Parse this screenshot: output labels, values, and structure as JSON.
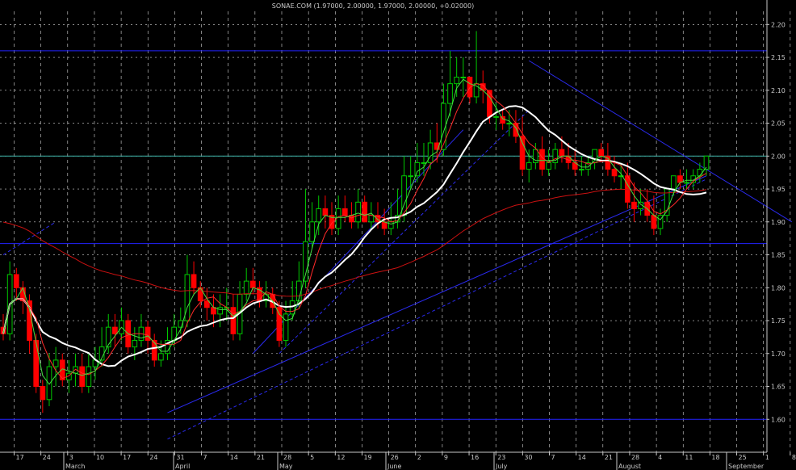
{
  "chart_data": {
    "type": "candlestick",
    "title": "SONAE.COM (1.97000, 2.00000, 1.97000, 2.00000, +0.02000)",
    "ylim": [
      1.55,
      2.22
    ],
    "y_ticks": [
      1.6,
      1.65,
      1.7,
      1.75,
      1.8,
      1.85,
      1.9,
      1.95,
      2.0,
      2.05,
      2.1,
      2.15,
      2.2
    ],
    "y_tick_labels": [
      "1.60",
      "1.65",
      "1.70",
      "1.75",
      "1.80",
      "1.85",
      "1.90",
      "1.95",
      "2.00",
      "2.05",
      "2.10",
      "2.15",
      "2.20"
    ],
    "x_day_labels": [
      "17",
      "24",
      "3",
      "10",
      "17",
      "24",
      "31",
      "7",
      "14",
      "21",
      "28",
      "5",
      "12",
      "19",
      "26",
      "2",
      "9",
      "16",
      "23",
      "30",
      "7",
      "14",
      "21",
      "28",
      "4",
      "11",
      "18",
      "25",
      "1",
      "8"
    ],
    "x_month_labels": [
      "March",
      "April",
      "May",
      "June",
      "July",
      "August",
      "September"
    ],
    "grid": true,
    "up_color": "#00c800",
    "down_color": "#ff0000",
    "colors": {
      "background": "#000000",
      "grid": "#d8d8d8",
      "ma_short": "#44dd44",
      "ma_mid": "#ff2a2a",
      "ma_white": "#ffffff",
      "ma_long": "#cc1111",
      "support_resistance": "#2222ff",
      "highlight_line": "#3fb4a8",
      "trendline": "#2a2aee"
    },
    "horizontal_levels": [
      2.16,
      2.0,
      1.867,
      1.6
    ],
    "series": [
      {
        "open": [
          1.74,
          1.73,
          1.82,
          1.8,
          1.78,
          1.72,
          1.65,
          1.63,
          1.68,
          1.69,
          1.66,
          1.67,
          1.68,
          1.65,
          1.68,
          1.69,
          1.71,
          1.74,
          1.73,
          1.75,
          1.71,
          1.72,
          1.74,
          1.72,
          1.69,
          1.7,
          1.72,
          1.74,
          1.75,
          1.82,
          1.8,
          1.78,
          1.77,
          1.76,
          1.77,
          1.77,
          1.73,
          1.79,
          1.81,
          1.8,
          1.78,
          1.79,
          1.77,
          1.72,
          1.76,
          1.78,
          1.81,
          1.87,
          1.9,
          1.92,
          1.91,
          1.89,
          1.92,
          1.91,
          1.9,
          1.93,
          1.9,
          1.91,
          1.9,
          1.89,
          1.9,
          1.91,
          1.97,
          1.97,
          1.99,
          1.99,
          2.02,
          2.01,
          2.08,
          2.11,
          2.12,
          2.12,
          2.09,
          2.11,
          2.1,
          2.06,
          2.06,
          2.05,
          2.05,
          2.03,
          1.98,
          1.99,
          2.01,
          1.98,
          1.99,
          2.01,
          2.0,
          1.99,
          1.98,
          1.98,
          1.99,
          2.01,
          2.0,
          1.98,
          1.97,
          1.97,
          1.93,
          1.92,
          1.93,
          1.91,
          1.89,
          1.91,
          1.95,
          1.97,
          1.96,
          1.96,
          1.97,
          1.98
        ],
        "close": [
          1.73,
          1.82,
          1.8,
          1.78,
          1.72,
          1.65,
          1.63,
          1.68,
          1.69,
          1.66,
          1.67,
          1.68,
          1.65,
          1.68,
          1.69,
          1.71,
          1.74,
          1.73,
          1.75,
          1.71,
          1.72,
          1.74,
          1.72,
          1.69,
          1.7,
          1.72,
          1.74,
          1.75,
          1.82,
          1.8,
          1.78,
          1.77,
          1.76,
          1.77,
          1.77,
          1.73,
          1.79,
          1.81,
          1.8,
          1.78,
          1.79,
          1.77,
          1.72,
          1.76,
          1.78,
          1.81,
          1.87,
          1.9,
          1.92,
          1.91,
          1.89,
          1.92,
          1.91,
          1.9,
          1.93,
          1.9,
          1.91,
          1.9,
          1.89,
          1.9,
          1.91,
          1.97,
          1.97,
          1.99,
          1.99,
          2.02,
          2.01,
          2.08,
          2.11,
          2.12,
          2.12,
          2.09,
          2.11,
          2.1,
          2.06,
          2.06,
          2.05,
          2.05,
          2.03,
          1.98,
          1.99,
          2.01,
          1.98,
          1.99,
          2.01,
          2.0,
          1.99,
          1.98,
          1.98,
          1.99,
          2.01,
          2.0,
          1.98,
          1.97,
          1.97,
          1.93,
          1.92,
          1.93,
          1.91,
          1.89,
          1.91,
          1.95,
          1.97,
          1.96,
          1.96,
          1.97,
          1.98,
          2.0
        ],
        "high": [
          1.76,
          1.84,
          1.83,
          1.81,
          1.79,
          1.73,
          1.66,
          1.7,
          1.71,
          1.7,
          1.69,
          1.7,
          1.7,
          1.7,
          1.71,
          1.74,
          1.76,
          1.76,
          1.77,
          1.76,
          1.74,
          1.76,
          1.75,
          1.73,
          1.72,
          1.74,
          1.76,
          1.77,
          1.85,
          1.84,
          1.81,
          1.8,
          1.79,
          1.79,
          1.8,
          1.79,
          1.81,
          1.83,
          1.83,
          1.81,
          1.81,
          1.8,
          1.78,
          1.78,
          1.81,
          1.84,
          1.95,
          1.93,
          1.94,
          1.94,
          1.93,
          1.94,
          1.94,
          1.93,
          1.95,
          1.94,
          1.93,
          1.93,
          1.92,
          1.93,
          1.95,
          2.0,
          2.0,
          2.02,
          2.02,
          2.04,
          2.05,
          2.11,
          2.16,
          2.15,
          2.15,
          2.12,
          2.19,
          2.13,
          2.1,
          2.08,
          2.07,
          2.07,
          2.07,
          2.06,
          2.01,
          2.02,
          2.03,
          2.01,
          2.02,
          2.03,
          2.02,
          2.01,
          2.0,
          2.0,
          2.01,
          2.02,
          2.02,
          2.0,
          1.99,
          1.99,
          1.96,
          1.95,
          1.95,
          1.94,
          1.92,
          1.93,
          1.97,
          1.98,
          1.98,
          1.98,
          1.99,
          2.0
        ],
        "low": [
          1.72,
          1.72,
          1.78,
          1.76,
          1.7,
          1.64,
          1.61,
          1.62,
          1.65,
          1.65,
          1.64,
          1.65,
          1.64,
          1.64,
          1.66,
          1.68,
          1.7,
          1.71,
          1.72,
          1.7,
          1.69,
          1.71,
          1.7,
          1.68,
          1.68,
          1.69,
          1.71,
          1.73,
          1.74,
          1.79,
          1.77,
          1.75,
          1.74,
          1.74,
          1.75,
          1.72,
          1.72,
          1.78,
          1.79,
          1.77,
          1.77,
          1.76,
          1.71,
          1.71,
          1.75,
          1.77,
          1.8,
          1.86,
          1.88,
          1.89,
          1.88,
          1.88,
          1.9,
          1.89,
          1.89,
          1.9,
          1.89,
          1.89,
          1.88,
          1.88,
          1.89,
          1.9,
          1.95,
          1.96,
          1.97,
          1.98,
          1.99,
          2.0,
          2.06,
          2.09,
          2.09,
          2.08,
          2.08,
          2.08,
          2.05,
          2.04,
          2.04,
          2.03,
          2.02,
          1.97,
          1.96,
          1.98,
          1.97,
          1.97,
          1.98,
          1.99,
          1.98,
          1.97,
          1.97,
          1.97,
          1.98,
          1.99,
          1.97,
          1.96,
          1.95,
          1.92,
          1.9,
          1.91,
          1.9,
          1.88,
          1.88,
          1.9,
          1.94,
          1.95,
          1.95,
          1.95,
          1.96,
          1.97
        ]
      }
    ]
  }
}
